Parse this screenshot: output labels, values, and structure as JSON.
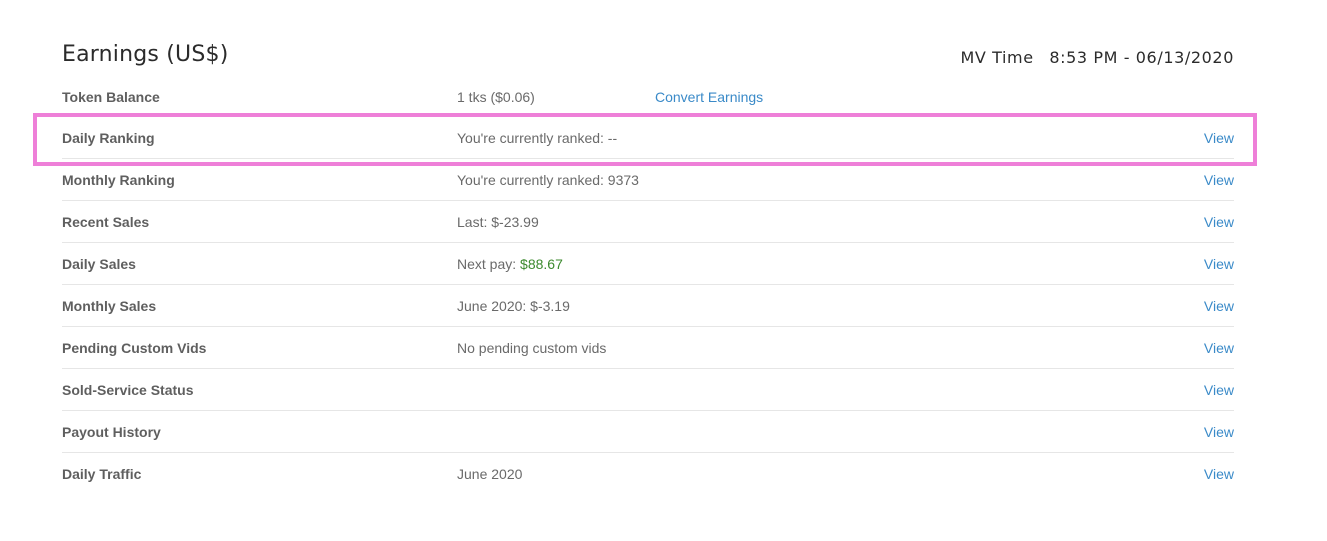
{
  "header": {
    "title": "Earnings (US$)",
    "time_label": "MV Time",
    "time_value": "8:53 PM - 06/13/2020"
  },
  "rows": [
    {
      "label": "Token Balance",
      "value": "1 tks ($0.06)",
      "action": "Convert Earnings"
    },
    {
      "label": "Daily Ranking",
      "value": "You're currently ranked: --",
      "action": "View"
    },
    {
      "label": "Monthly Ranking",
      "value": "You're currently ranked: 9373",
      "action": "View"
    },
    {
      "label": "Recent Sales",
      "value": "Last: $-23.99",
      "action": "View"
    },
    {
      "label": "Daily Sales",
      "value_prefix": "Next pay: ",
      "value_money": "$88.67",
      "action": "View"
    },
    {
      "label": "Monthly Sales",
      "value": "June 2020: $-3.19",
      "action": "View"
    },
    {
      "label": "Pending Custom Vids",
      "value": "No pending custom vids",
      "action": "View"
    },
    {
      "label": "Sold-Service Status",
      "value": "",
      "action": "View"
    },
    {
      "label": "Payout History",
      "value": "",
      "action": "View"
    },
    {
      "label": "Daily Traffic",
      "value": "June 2020",
      "action": "View"
    }
  ],
  "highlight_color": "#ee7fd8",
  "link_color": "#3a8ac8",
  "money_color": "#3c8a2e"
}
